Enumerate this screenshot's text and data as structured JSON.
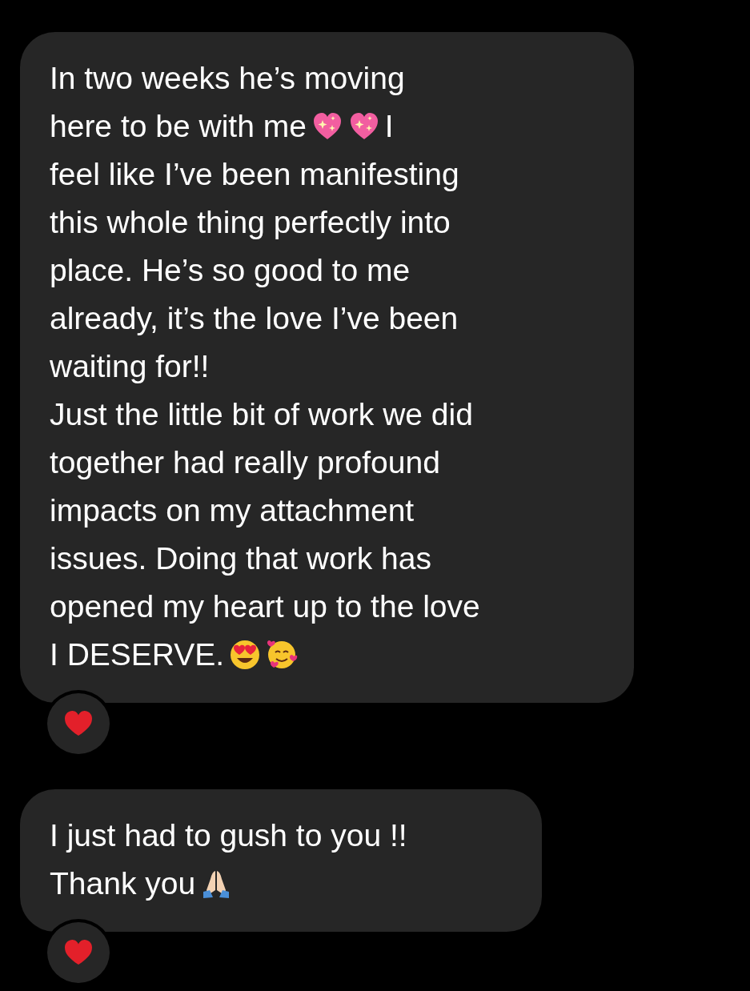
{
  "messages": [
    {
      "lines": [
        [
          {
            "kind": "text",
            "text": "In two weeks he’s moving"
          }
        ],
        [
          {
            "kind": "text",
            "text": "here to be with me"
          },
          {
            "kind": "sparkle-heart"
          },
          {
            "kind": "sparkle-heart"
          },
          {
            "kind": "text",
            "text": "I"
          }
        ],
        [
          {
            "kind": "text",
            "text": "feel like I’ve been manifesting"
          }
        ],
        [
          {
            "kind": "text",
            "text": "this whole thing perfectly into"
          }
        ],
        [
          {
            "kind": "text",
            "text": "place. He’s so good to me"
          }
        ],
        [
          {
            "kind": "text",
            "text": "already, it’s the love I’ve been"
          }
        ],
        [
          {
            "kind": "text",
            "text": "waiting for!!"
          }
        ],
        [
          {
            "kind": "text",
            "text": "Just the little bit of work we did"
          }
        ],
        [
          {
            "kind": "text",
            "text": "together had really profound"
          }
        ],
        [
          {
            "kind": "text",
            "text": "impacts on my attachment"
          }
        ],
        [
          {
            "kind": "text",
            "text": "issues. Doing that work has"
          }
        ],
        [
          {
            "kind": "text",
            "text": "opened my heart up to the love"
          }
        ],
        [
          {
            "kind": "text",
            "text": "I DESERVE."
          },
          {
            "kind": "heart-eyes"
          },
          {
            "kind": "hearts-face"
          }
        ]
      ],
      "reaction": {
        "kind": "heart"
      }
    },
    {
      "lines": [
        [
          {
            "kind": "text",
            "text": "I just had to gush to you !!"
          }
        ],
        [
          {
            "kind": "text",
            "text": "Thank you"
          },
          {
            "kind": "folded-hands"
          }
        ]
      ],
      "reaction": {
        "kind": "heart"
      }
    }
  ]
}
